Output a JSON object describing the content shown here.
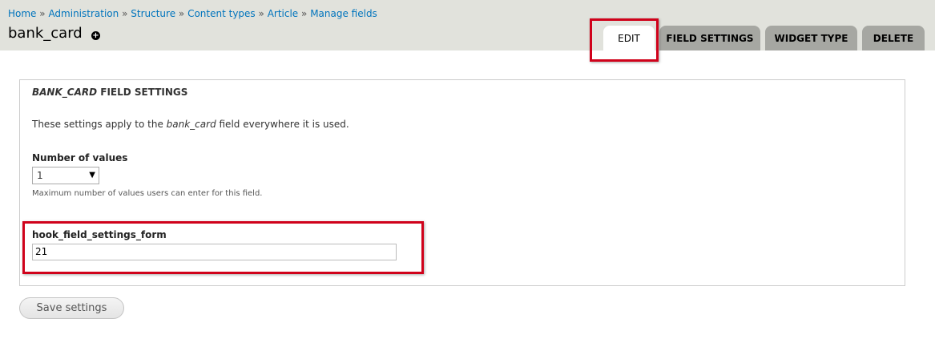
{
  "breadcrumb": {
    "items": [
      "Home",
      "Administration",
      "Structure",
      "Content types",
      "Article",
      "Manage fields"
    ],
    "separator": "»"
  },
  "page_title": "bank_card",
  "shortcut_icon": "add-shortcut-icon",
  "tabs": [
    {
      "label": "EDIT",
      "active": true
    },
    {
      "label": "FIELD SETTINGS",
      "active": false
    },
    {
      "label": "WIDGET TYPE",
      "active": false
    },
    {
      "label": "DELETE",
      "active": false
    }
  ],
  "fieldset": {
    "legend_em": "BANK_CARD",
    "legend_rest": " FIELD SETTINGS",
    "desc_pre": "These settings apply to the ",
    "desc_em": "bank_card",
    "desc_post": " field everywhere it is used."
  },
  "number_of_values": {
    "label": "Number of values",
    "selected": "1",
    "help": "Maximum number of values users can enter for this field."
  },
  "hook_field": {
    "label": "hook_field_settings_form",
    "value": "21"
  },
  "save_button": "Save settings",
  "colors": {
    "link": "#0074bd",
    "header_bg": "#e1e2dc",
    "tab_bg": "#a6a7a2",
    "highlight": "#d0021b"
  }
}
